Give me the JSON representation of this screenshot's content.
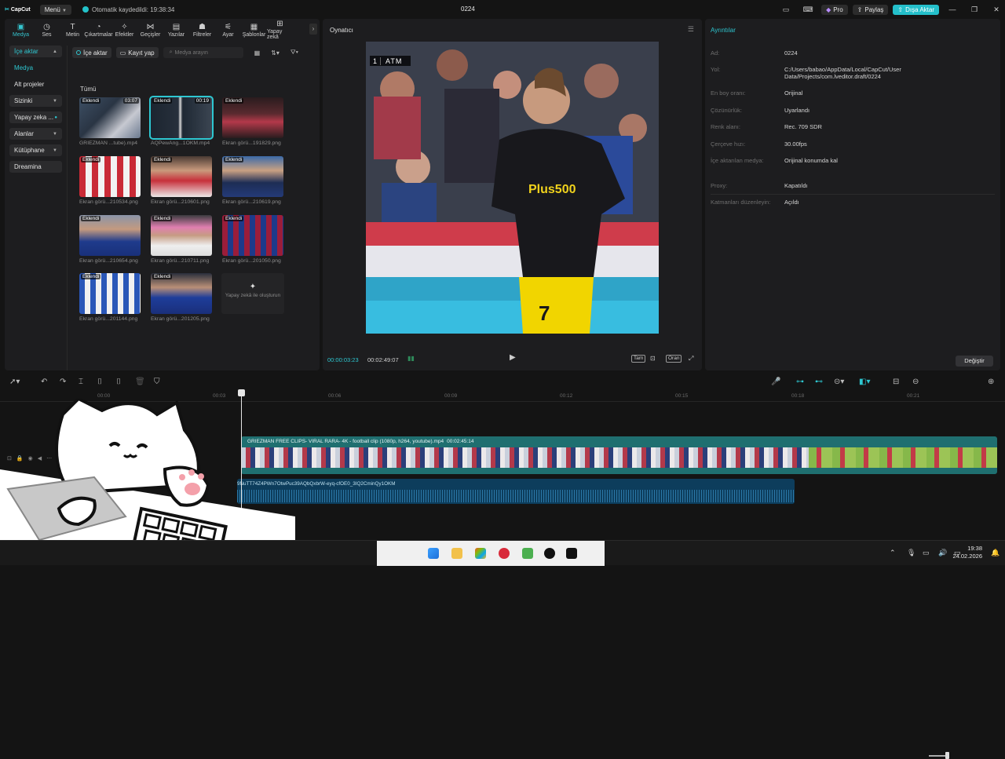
{
  "app": {
    "logo": "CapCut",
    "menu": "Menü",
    "autosave": "Otomatik kaydedildi: 19:38:34",
    "project_title": "0224",
    "pro": "Pro",
    "share": "Paylaş",
    "export": "Dışa Aktar"
  },
  "tools": [
    {
      "label": "Medya",
      "icon": "media-icon"
    },
    {
      "label": "Ses",
      "icon": "audio-icon"
    },
    {
      "label": "Metin",
      "icon": "text-icon"
    },
    {
      "label": "Çıkartmalar",
      "icon": "sticker-icon"
    },
    {
      "label": "Efektler",
      "icon": "effects-icon"
    },
    {
      "label": "Geçişler",
      "icon": "transitions-icon"
    },
    {
      "label": "Yazılar",
      "icon": "captions-icon"
    },
    {
      "label": "Filtreler",
      "icon": "filters-icon"
    },
    {
      "label": "Ayar",
      "icon": "adjust-icon"
    },
    {
      "label": "Şablonlar",
      "icon": "templates-icon"
    },
    {
      "label": "Yapay zekâ",
      "icon": "ai-icon"
    }
  ],
  "sidenav": [
    "İçe aktar",
    "Medya",
    "Alt projeler",
    "Sizinki",
    "Yapay zeka ...",
    "Alanlar",
    "Kütüphane",
    "Dreamina"
  ],
  "media_toolbar": {
    "import": "İçe aktar",
    "record": "Kayıt yap",
    "search_placeholder": "Medya arayın"
  },
  "all_label": "Tümü",
  "media": [
    {
      "tag": "Eklendi",
      "duration": "03:07",
      "name": "GRIEZMAN ...tube).mp4"
    },
    {
      "tag": "Eklendi",
      "duration": "00:19",
      "name": "AQPewAng...1OKM.mp4"
    },
    {
      "tag": "Eklendi",
      "duration": "",
      "name": "Ekran görü...191829.png"
    },
    {
      "tag": "Eklendi",
      "duration": "",
      "name": "Ekran görü...210534.png"
    },
    {
      "tag": "Eklendi",
      "duration": "",
      "name": "Ekran görü...210601.png"
    },
    {
      "tag": "Eklendi",
      "duration": "",
      "name": "Ekran görü...210619.png"
    },
    {
      "tag": "Eklendi",
      "duration": "",
      "name": "Ekran görü...210654.png"
    },
    {
      "tag": "Eklendi",
      "duration": "",
      "name": "Ekran görü...210711.png"
    },
    {
      "tag": "Eklendi",
      "duration": "",
      "name": "Ekran görü...201050.png"
    },
    {
      "tag": "Eklendi",
      "duration": "",
      "name": "Ekran görü...201144.png"
    },
    {
      "tag": "Eklendi",
      "duration": "",
      "name": "Ekran görü...201205.png"
    }
  ],
  "ai_create": "Yapay zekâ ile oluşturun",
  "player": {
    "title": "Oynatıcı",
    "score_num": "1",
    "score_team": "ATM",
    "current_time": "00:00:03:23",
    "total_time": "00:02:49:07",
    "full_label": "Tam",
    "ratio_label": "Oran"
  },
  "details": {
    "title": "Ayrıntılar",
    "rows": [
      {
        "label": "Ad:",
        "value": "0224"
      },
      {
        "label": "Yol:",
        "value": "C:/Users/babao/AppData/Local/CapCut/User Data/Projects/com.lveditor.draft/0224"
      },
      {
        "label": "En boy oranı:",
        "value": "Orijinal"
      },
      {
        "label": "Çözünürlük:",
        "value": "Uyarlandı"
      },
      {
        "label": "Renk alanı:",
        "value": "Rec. 709 SDR"
      },
      {
        "label": "Çerçeve hızı:",
        "value": "30.00fps"
      },
      {
        "label": "İçe aktarılan medya:",
        "value": "Orijinal konumda kal"
      },
      {
        "label": "Proxy:",
        "value": "Kapatıldı"
      },
      {
        "label": "Katmanları düzenleyin:",
        "value": "Açıldı"
      }
    ],
    "change": "Değiştir"
  },
  "timeline": {
    "ticks": [
      "00:00",
      "00:03",
      "00:06",
      "00:09",
      "00:12",
      "00:15",
      "00:18",
      "00:21"
    ],
    "video_clip_name": "GRIEZMAN FREE CLIPS- VIRAL RARA- 4K - football clip (1080p, h264, youtube).mp4",
    "video_clip_duration": "00:02:45:14",
    "audio_clip_name": "9NuTT74Z4PWn7OtwPuc39AQbQxbrW-eyq-cfOE0_3IQ2CminQy1OKM"
  },
  "taskbar": {
    "time": "19:38",
    "date": "24.02.2026"
  }
}
